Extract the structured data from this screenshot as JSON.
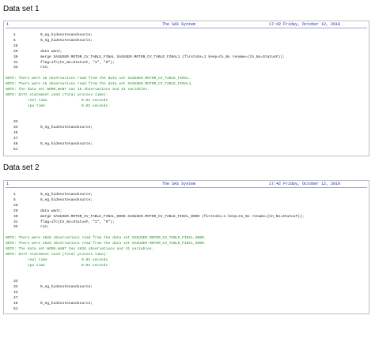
{
  "sections": [
    {
      "title": "Data set 1",
      "header": {
        "page_num": "1",
        "title": "The SAS System",
        "datetime": "17:42 Friday, October 12, 2018"
      },
      "lines": [
        {
          "kind": "code",
          "num": "1",
          "text": "%_eg_hidenotesandsource;"
        },
        {
          "kind": "code",
          "num": "5",
          "text": "%_eg_hidenotesandsource;"
        },
        {
          "kind": "code",
          "num": "28",
          "text": ""
        },
        {
          "kind": "code",
          "num": "29",
          "text": "data want;"
        },
        {
          "kind": "code",
          "num": "30",
          "text": "merge SASUSER.MOTOR_CV_TABLE_FINAL SASUSER.MOTOR_CV_TABLE_FINAL1 (firstobs=1 keep=Cn_No rename=(Cn_No=StatusF));"
        },
        {
          "kind": "code",
          "num": "31",
          "text": "flag=ifc(Cn_No=StatusF, \"1\", \"0\");"
        },
        {
          "kind": "code",
          "num": "32",
          "text": "run;"
        },
        {
          "kind": "blank"
        },
        {
          "kind": "note",
          "text": "NOTE: There were 16 observations read from the data set SASUSER.MOTOR_CV_TABLE_FINAL."
        },
        {
          "kind": "note",
          "text": "NOTE: There were 16 observations read from the data set SASUSER.MOTOR_CV_TABLE_FINAL1."
        },
        {
          "kind": "note",
          "text": "NOTE: The data set WORK.WANT has 16 observations and 41 variables."
        },
        {
          "kind": "note",
          "text": "NOTE: DATA statement used (Total process time):"
        },
        {
          "kind": "stat",
          "label": "real time",
          "value": "0.02 seconds"
        },
        {
          "kind": "stat",
          "label": "cpu time",
          "value": "0.03 seconds"
        },
        {
          "kind": "blank"
        },
        {
          "kind": "blank"
        },
        {
          "kind": "code",
          "num": "33",
          "text": ""
        },
        {
          "kind": "code",
          "num": "34",
          "text": "%_eg_hidenotesandsource;"
        },
        {
          "kind": "code",
          "num": "46",
          "text": ""
        },
        {
          "kind": "code",
          "num": "47",
          "text": ""
        },
        {
          "kind": "code",
          "num": "48",
          "text": "%_eg_hidenotesandsource;"
        },
        {
          "kind": "code",
          "num": "51",
          "text": ""
        }
      ]
    },
    {
      "title": "Data set 2",
      "header": {
        "page_num": "1",
        "title": "The SAS System",
        "datetime": "17:42 Friday, October 12, 2018"
      },
      "lines": [
        {
          "kind": "code",
          "num": "1",
          "text": "%_eg_hidenotesandsource;"
        },
        {
          "kind": "code",
          "num": "5",
          "text": "%_eg_hidenotesandsource;"
        },
        {
          "kind": "code",
          "num": "28",
          "text": ""
        },
        {
          "kind": "code",
          "num": "29",
          "text": "data want;"
        },
        {
          "kind": "code",
          "num": "30",
          "text": "merge SASUSER.MOTOR_CV_TABLE_FINAL_0000 SASUSER.MOTOR_CV_TABLE_FINAL_0000 (firstobs=1 keep=Cn_No rename=(Cn_No=StatusF));"
        },
        {
          "kind": "code",
          "num": "31",
          "text": "flag=ifc(Cn_No=StatusF, \"1\", \"0\");"
        },
        {
          "kind": "code",
          "num": "32",
          "text": "run;"
        },
        {
          "kind": "blank"
        },
        {
          "kind": "note",
          "text": "NOTE: There were 4626 observations read from the data set SASUSER.MOTOR_CV_TABLE_FINAL_0000."
        },
        {
          "kind": "note",
          "text": "NOTE: There were 4626 observations read from the data set SASUSER.MOTOR_CV_TABLE_FINAL_0000."
        },
        {
          "kind": "note",
          "text": "NOTE: The data set WORK.WANT has 4626 observations and 41 variables."
        },
        {
          "kind": "note",
          "text": "NOTE: DATA statement used (Total process time):"
        },
        {
          "kind": "stat",
          "label": "real time",
          "value": "0.03 seconds"
        },
        {
          "kind": "stat",
          "label": "cpu time",
          "value": "0.03 seconds"
        },
        {
          "kind": "blank"
        },
        {
          "kind": "blank"
        },
        {
          "kind": "code",
          "num": "33",
          "text": ""
        },
        {
          "kind": "code",
          "num": "34",
          "text": "%_eg_hidenotesandsource;"
        },
        {
          "kind": "code",
          "num": "44",
          "text": ""
        },
        {
          "kind": "code",
          "num": "47",
          "text": ""
        },
        {
          "kind": "code",
          "num": "48",
          "text": "%_eg_hidenotesandsource;"
        },
        {
          "kind": "code",
          "num": "51",
          "text": ""
        }
      ]
    }
  ],
  "colors": {
    "header_text": "#2323b4",
    "note_text": "#1f8f22",
    "code_text": "#1a1a1a"
  }
}
